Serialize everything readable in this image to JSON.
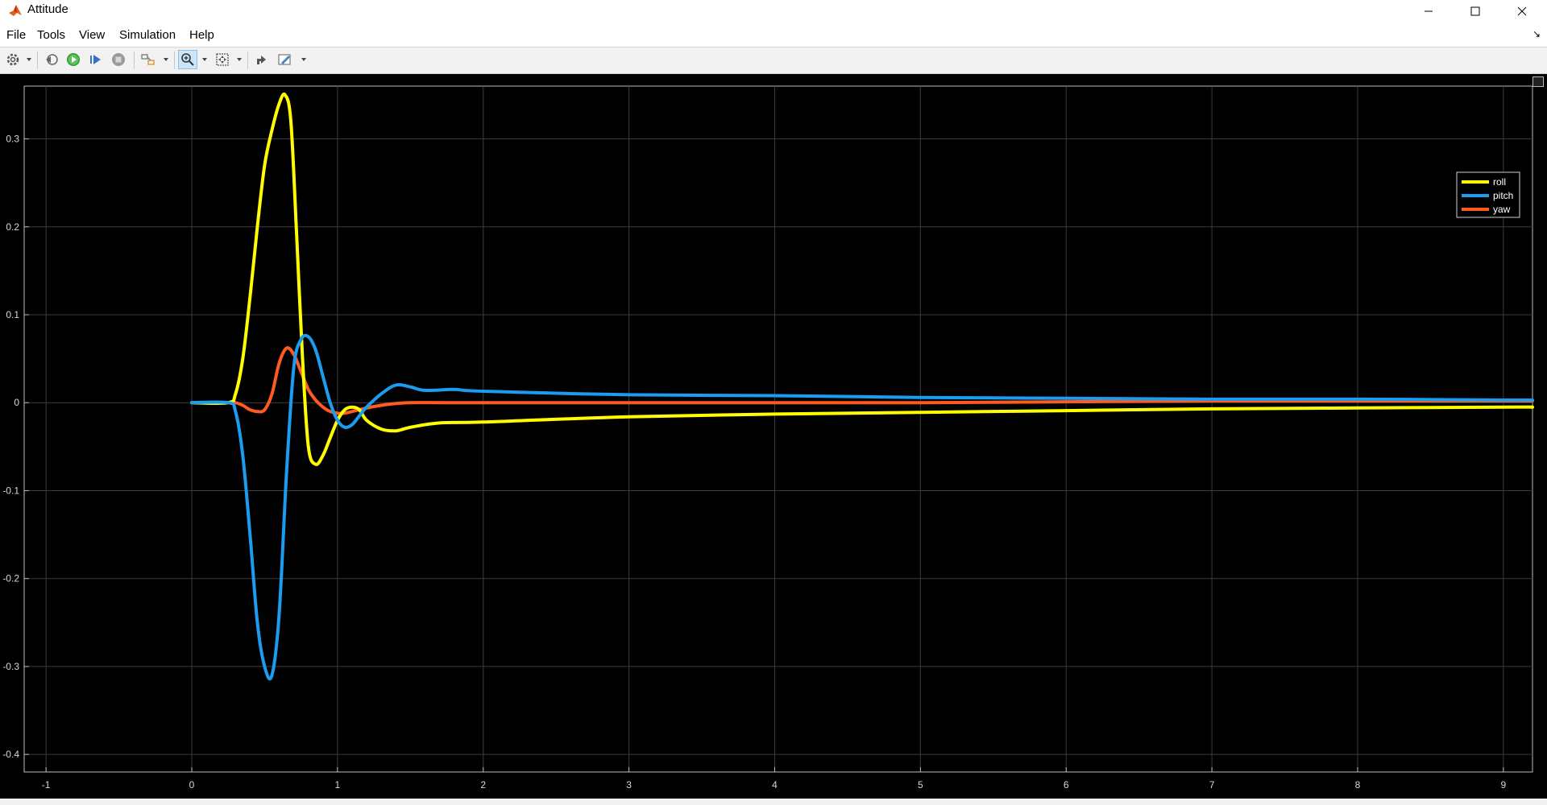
{
  "window": {
    "title": "Attitude"
  },
  "menu": {
    "items": [
      "File",
      "Tools",
      "View",
      "Simulation",
      "Help"
    ]
  },
  "toolbar": {
    "buttons": [
      "settings-icon",
      "step-back-icon",
      "run-icon",
      "step-forward-icon",
      "stop-icon",
      "highlight-icon",
      "zoom-icon",
      "autoscale-icon",
      "restore-icon",
      "properties-icon"
    ]
  },
  "colors": {
    "roll": "#ffff00",
    "pitch": "#1a9cf0",
    "yaw": "#ff5a1f",
    "background": "#000000",
    "grid": "#3c3c3c"
  },
  "chart_data": {
    "type": "line",
    "title": "",
    "xlabel": "",
    "ylabel": "",
    "xlim": [
      -1.15,
      9.2
    ],
    "ylim": [
      -0.42,
      0.36
    ],
    "xticks": [
      -1,
      0,
      1,
      2,
      3,
      4,
      5,
      6,
      7,
      8,
      9
    ],
    "yticks": [
      -0.4,
      -0.3,
      -0.2,
      -0.1,
      0,
      0.1,
      0.2,
      0.3
    ],
    "ytick_labels": [
      "-0.4",
      "-0.3",
      "-0.2",
      "-0.1",
      "0",
      "0.1",
      "0.2",
      "0.3"
    ],
    "grid": true,
    "legend": "top-right",
    "series": [
      {
        "name": "roll",
        "x": [
          0,
          0.25,
          0.3,
          0.35,
          0.4,
          0.45,
          0.5,
          0.55,
          0.6,
          0.64,
          0.68,
          0.72,
          0.76,
          0.8,
          0.85,
          0.9,
          0.95,
          1.0,
          1.05,
          1.1,
          1.15,
          1.2,
          1.3,
          1.4,
          1.5,
          1.7,
          2.0,
          3.0,
          4.0,
          5.0,
          6.0,
          7.0,
          8.0,
          9.0,
          9.2
        ],
        "y": [
          0,
          0,
          0.01,
          0.05,
          0.12,
          0.2,
          0.27,
          0.31,
          0.34,
          0.35,
          0.32,
          0.19,
          0.05,
          -0.05,
          -0.07,
          -0.06,
          -0.04,
          -0.02,
          -0.008,
          -0.005,
          -0.008,
          -0.02,
          -0.03,
          -0.032,
          -0.028,
          -0.023,
          -0.022,
          -0.016,
          -0.013,
          -0.011,
          -0.009,
          -0.007,
          -0.006,
          -0.005,
          -0.005
        ]
      },
      {
        "name": "pitch",
        "x": [
          0,
          0.25,
          0.3,
          0.35,
          0.4,
          0.45,
          0.5,
          0.55,
          0.6,
          0.65,
          0.7,
          0.75,
          0.8,
          0.85,
          0.9,
          0.95,
          1.0,
          1.05,
          1.1,
          1.15,
          1.2,
          1.3,
          1.4,
          1.5,
          1.6,
          1.8,
          2.0,
          3.0,
          4.0,
          5.0,
          6.0,
          7.0,
          8.0,
          9.0,
          9.2
        ],
        "y": [
          0,
          0,
          -0.01,
          -0.06,
          -0.15,
          -0.25,
          -0.3,
          -0.31,
          -0.24,
          -0.08,
          0.04,
          0.072,
          0.075,
          0.06,
          0.03,
          0,
          -0.02,
          -0.028,
          -0.025,
          -0.015,
          -0.005,
          0.01,
          0.02,
          0.018,
          0.014,
          0.015,
          0.013,
          0.009,
          0.008,
          0.006,
          0.005,
          0.004,
          0.004,
          0.003,
          0.003
        ]
      },
      {
        "name": "yaw",
        "x": [
          0,
          0.25,
          0.3,
          0.35,
          0.4,
          0.45,
          0.5,
          0.55,
          0.6,
          0.65,
          0.7,
          0.75,
          0.8,
          0.85,
          0.9,
          0.95,
          1.0,
          1.05,
          1.1,
          1.2,
          1.3,
          1.4,
          1.5,
          1.7,
          2.0,
          3.0,
          4.0,
          5.0,
          6.0,
          7.0,
          8.0,
          9.0,
          9.2
        ],
        "y": [
          0,
          0,
          0,
          -0.003,
          -0.008,
          -0.01,
          -0.008,
          0.01,
          0.045,
          0.062,
          0.055,
          0.035,
          0.015,
          0.003,
          -0.005,
          -0.01,
          -0.012,
          -0.012,
          -0.01,
          -0.006,
          -0.003,
          -0.001,
          0,
          0,
          0,
          0,
          0,
          0,
          0.001,
          0.002,
          0.002,
          0.002,
          0.002
        ]
      }
    ]
  }
}
